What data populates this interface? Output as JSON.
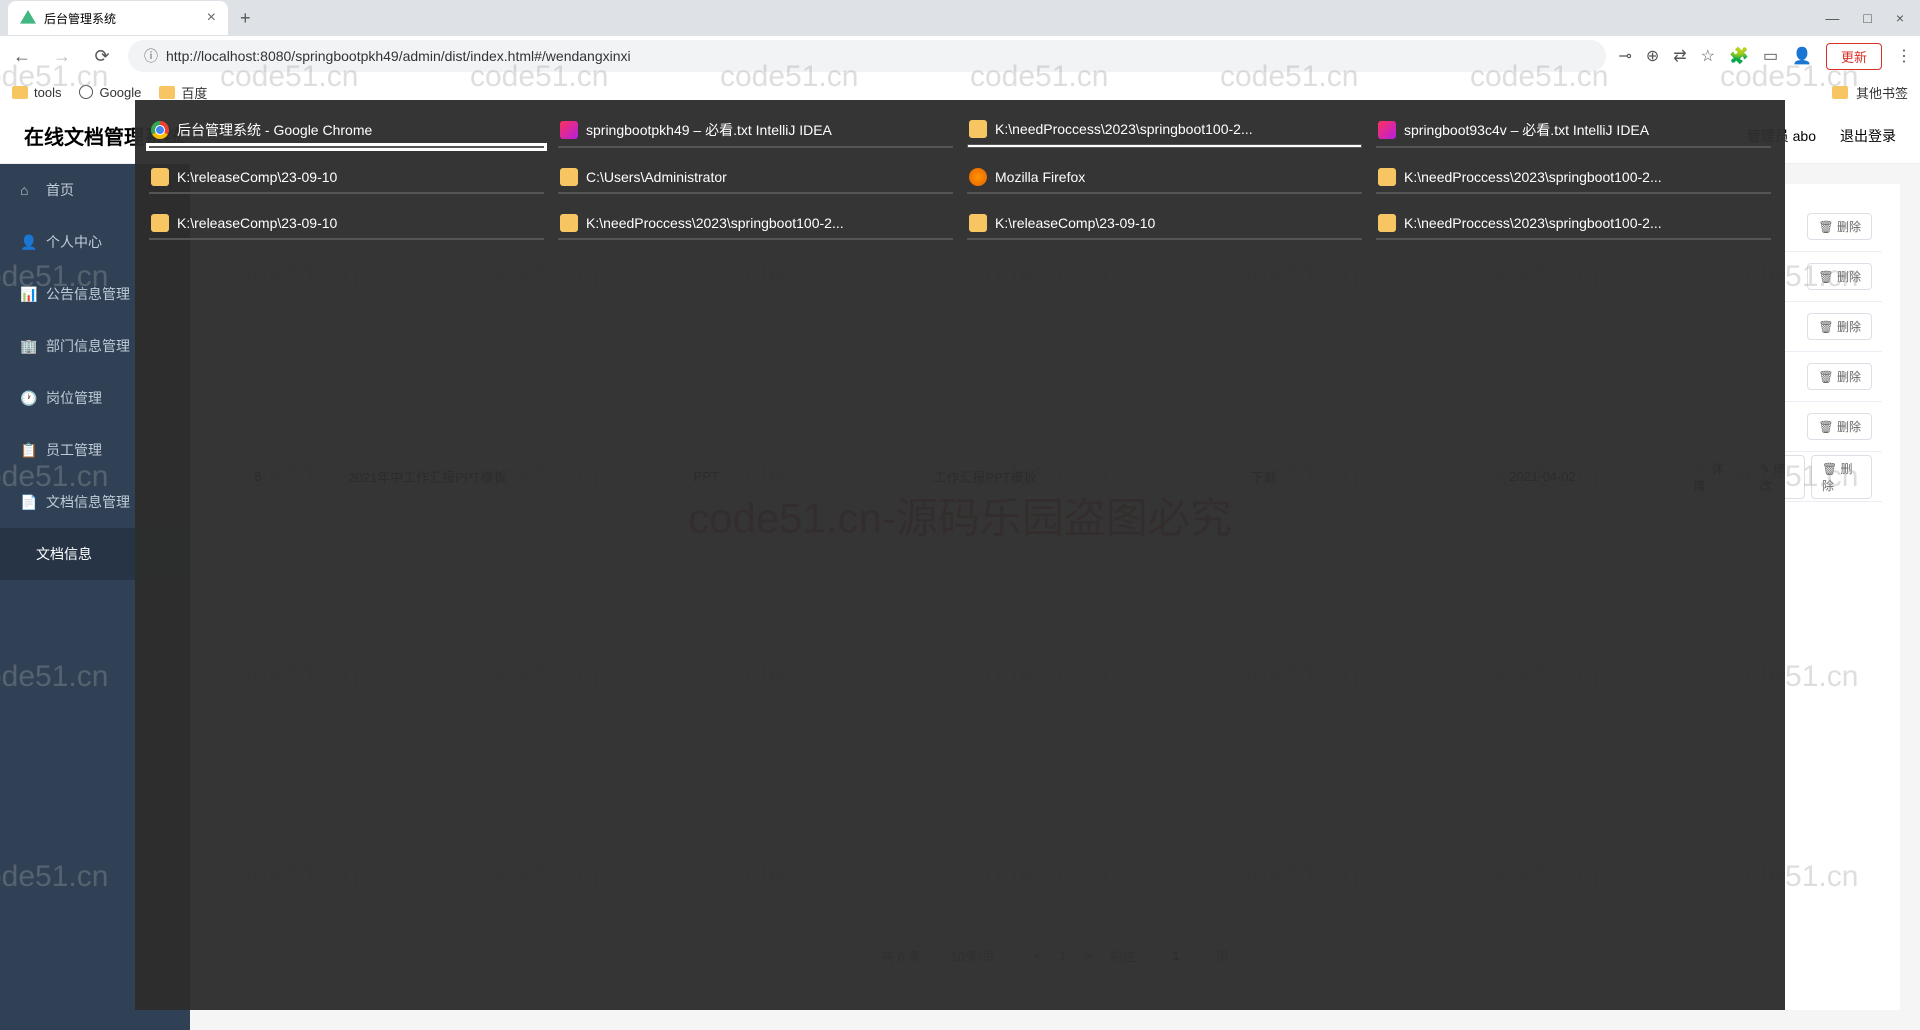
{
  "browser": {
    "tab_title": "后台管理系统",
    "new_tab": "+",
    "close_tab": "×",
    "window_min": "—",
    "window_max": "□",
    "window_close": "×",
    "url": "http://localhost:8080/springbootpkh49/admin/dist/index.html#/wendangxinxi",
    "update_btn": "更新",
    "bookmarks": {
      "tools": "tools",
      "google": "Google",
      "baidu": "百度",
      "other": "其他书签"
    }
  },
  "app": {
    "title": "在线文档管理系统",
    "role_label": "管理员 abo",
    "logout": "退出登录",
    "sidebar": {
      "home": "首页",
      "personal": "个人中心",
      "notice": "公告信息管理",
      "dept": "部门信息管理",
      "position": "岗位管理",
      "staff": "员工管理",
      "docmgmt": "文档信息管理",
      "docinfo": "文档信息"
    },
    "table": {
      "rows": [
        {
          "id": "6",
          "name": "2021年中工作汇报PPT模板",
          "type": "PPT",
          "desc": "工作汇报PPT模板",
          "dept": "下载",
          "date": "2021-04-02"
        }
      ],
      "action_detail": "详情",
      "action_edit": "修改",
      "action_delete": "删除"
    },
    "pagination": {
      "total": "共 6 条",
      "per_page": "10条/页",
      "prev": "<",
      "page": "1",
      "next": ">",
      "goto": "前往",
      "goto_input": "1",
      "page_suffix": "页"
    }
  },
  "alttab": {
    "windows": [
      {
        "title": "后台管理系统 - Google Chrome",
        "icon": "chrome",
        "preview": "admin",
        "selected": true
      },
      {
        "title": "springbootpkh49 – 必看.txt IntelliJ IDEA",
        "icon": "idea",
        "preview": "dark"
      },
      {
        "title": "K:\\needProccess\\2023\\springboot100-2...",
        "icon": "folder",
        "preview": "explorer"
      },
      {
        "title": "springboot93c4v – 必看.txt IntelliJ IDEA",
        "icon": "idea",
        "preview": "dark"
      },
      {
        "title": "K:\\releaseComp\\23-09-10",
        "icon": "folder",
        "preview": "explorer"
      },
      {
        "title": "C:\\Users\\Administrator",
        "icon": "folder",
        "preview": "explorer"
      },
      {
        "title": "Mozilla Firefox",
        "icon": "firefox",
        "preview": "light"
      },
      {
        "title": "K:\\needProccess\\2023\\springboot100-2...",
        "icon": "folder",
        "preview": "explorer"
      },
      {
        "title": "K:\\releaseComp\\23-09-10",
        "icon": "folder",
        "preview": "explorer"
      },
      {
        "title": "K:\\needProccess\\2023\\springboot100-2...",
        "icon": "folder",
        "preview": "explorer"
      },
      {
        "title": "K:\\releaseComp\\23-09-10",
        "icon": "folder",
        "preview": "explorer"
      },
      {
        "title": "K:\\needProccess\\2023\\springboot100-2...",
        "icon": "folder",
        "preview": "explorer"
      }
    ]
  },
  "watermark": {
    "text": "code51.cn",
    "center": "code51.cn-源码乐园盗图必究"
  }
}
